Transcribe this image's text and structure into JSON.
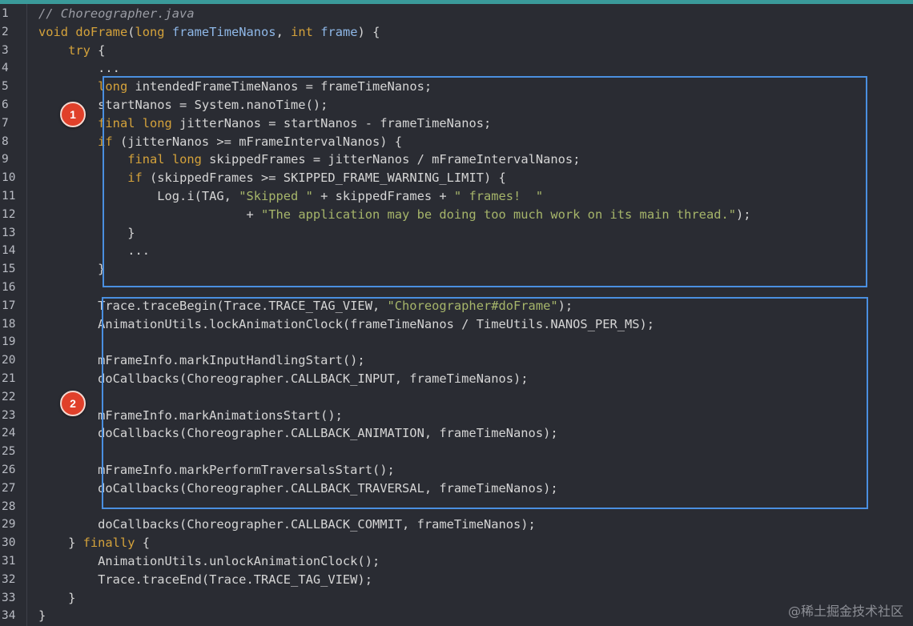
{
  "file_comment": "// Choreographer.java",
  "lines": [
    {
      "num": "1",
      "tokens": [
        {
          "t": "// Choreographer.java",
          "c": "cmt"
        }
      ]
    },
    {
      "num": "2",
      "tokens": [
        {
          "t": "void ",
          "c": "kw"
        },
        {
          "t": "doFrame",
          "c": "fn"
        },
        {
          "t": "(",
          "c": ""
        },
        {
          "t": "long ",
          "c": "kw"
        },
        {
          "t": "frameTimeNanos",
          "c": "prm"
        },
        {
          "t": ", ",
          "c": ""
        },
        {
          "t": "int ",
          "c": "kw"
        },
        {
          "t": "frame",
          "c": "prm"
        },
        {
          "t": ") {",
          "c": ""
        }
      ]
    },
    {
      "num": "3",
      "tokens": [
        {
          "t": "    ",
          "c": ""
        },
        {
          "t": "try",
          "c": "kw"
        },
        {
          "t": " {",
          "c": ""
        }
      ]
    },
    {
      "num": "4",
      "tokens": [
        {
          "t": "        ...",
          "c": ""
        }
      ]
    },
    {
      "num": "5",
      "tokens": [
        {
          "t": "        ",
          "c": ""
        },
        {
          "t": "long ",
          "c": "kw"
        },
        {
          "t": "intendedFrameTimeNanos = frameTimeNanos;",
          "c": ""
        }
      ]
    },
    {
      "num": "6",
      "tokens": [
        {
          "t": "        startNanos = System.nanoTime();",
          "c": ""
        }
      ]
    },
    {
      "num": "7",
      "tokens": [
        {
          "t": "        ",
          "c": ""
        },
        {
          "t": "final ",
          "c": "kw"
        },
        {
          "t": "long ",
          "c": "kw"
        },
        {
          "t": "jitterNanos = startNanos - frameTimeNanos;",
          "c": ""
        }
      ]
    },
    {
      "num": "8",
      "tokens": [
        {
          "t": "        ",
          "c": ""
        },
        {
          "t": "if",
          "c": "kw"
        },
        {
          "t": " (jitterNanos >= mFrameIntervalNanos) {",
          "c": ""
        }
      ]
    },
    {
      "num": "9",
      "tokens": [
        {
          "t": "            ",
          "c": ""
        },
        {
          "t": "final ",
          "c": "kw"
        },
        {
          "t": "long ",
          "c": "kw"
        },
        {
          "t": "skippedFrames = jitterNanos / mFrameIntervalNanos;",
          "c": ""
        }
      ]
    },
    {
      "num": "10",
      "tokens": [
        {
          "t": "            ",
          "c": ""
        },
        {
          "t": "if",
          "c": "kw"
        },
        {
          "t": " (skippedFrames >= SKIPPED_FRAME_WARNING_LIMIT) {",
          "c": ""
        }
      ]
    },
    {
      "num": "11",
      "tokens": [
        {
          "t": "                Log.i(TAG, ",
          "c": ""
        },
        {
          "t": "\"Skipped \"",
          "c": "str"
        },
        {
          "t": " + skippedFrames + ",
          "c": ""
        },
        {
          "t": "\" frames!  \"",
          "c": "str"
        }
      ]
    },
    {
      "num": "12",
      "tokens": [
        {
          "t": "                            + ",
          "c": ""
        },
        {
          "t": "\"The application may be doing too much work on its main thread.\"",
          "c": "str"
        },
        {
          "t": ");",
          "c": ""
        }
      ]
    },
    {
      "num": "13",
      "tokens": [
        {
          "t": "            }",
          "c": ""
        }
      ]
    },
    {
      "num": "14",
      "tokens": [
        {
          "t": "            ...",
          "c": ""
        }
      ]
    },
    {
      "num": "15",
      "tokens": [
        {
          "t": "        }",
          "c": ""
        }
      ]
    },
    {
      "num": "16",
      "tokens": []
    },
    {
      "num": "17",
      "tokens": [
        {
          "t": "        Trace.traceBegin(Trace.TRACE_TAG_VIEW, ",
          "c": ""
        },
        {
          "t": "\"Choreographer#doFrame\"",
          "c": "str"
        },
        {
          "t": ");",
          "c": ""
        }
      ]
    },
    {
      "num": "18",
      "tokens": [
        {
          "t": "        AnimationUtils.lockAnimationClock(frameTimeNanos / TimeUtils.NANOS_PER_MS);",
          "c": ""
        }
      ]
    },
    {
      "num": "19",
      "tokens": []
    },
    {
      "num": "20",
      "tokens": [
        {
          "t": "        mFrameInfo.markInputHandlingStart();",
          "c": ""
        }
      ]
    },
    {
      "num": "21",
      "tokens": [
        {
          "t": "        doCallbacks(Choreographer.CALLBACK_INPUT, frameTimeNanos);",
          "c": ""
        }
      ]
    },
    {
      "num": "22",
      "tokens": []
    },
    {
      "num": "23",
      "tokens": [
        {
          "t": "        mFrameInfo.markAnimationsStart();",
          "c": ""
        }
      ]
    },
    {
      "num": "24",
      "tokens": [
        {
          "t": "        doCallbacks(Choreographer.CALLBACK_ANIMATION, frameTimeNanos);",
          "c": ""
        }
      ]
    },
    {
      "num": "25",
      "tokens": []
    },
    {
      "num": "26",
      "tokens": [
        {
          "t": "        mFrameInfo.markPerformTraversalsStart();",
          "c": ""
        }
      ]
    },
    {
      "num": "27",
      "tokens": [
        {
          "t": "        doCallbacks(Choreographer.CALLBACK_TRAVERSAL, frameTimeNanos);",
          "c": ""
        }
      ]
    },
    {
      "num": "28",
      "tokens": []
    },
    {
      "num": "29",
      "tokens": [
        {
          "t": "        doCallbacks(Choreographer.CALLBACK_COMMIT, frameTimeNanos);",
          "c": ""
        }
      ]
    },
    {
      "num": "30",
      "tokens": [
        {
          "t": "    } ",
          "c": ""
        },
        {
          "t": "finally",
          "c": "kw"
        },
        {
          "t": " {",
          "c": ""
        }
      ]
    },
    {
      "num": "31",
      "tokens": [
        {
          "t": "        AnimationUtils.unlockAnimationClock();",
          "c": ""
        }
      ]
    },
    {
      "num": "32",
      "tokens": [
        {
          "t": "        Trace.traceEnd(Trace.TRACE_TAG_VIEW);",
          "c": ""
        }
      ]
    },
    {
      "num": "33",
      "tokens": [
        {
          "t": "    }",
          "c": ""
        }
      ]
    },
    {
      "num": "34",
      "tokens": [
        {
          "t": "}",
          "c": ""
        }
      ]
    }
  ],
  "badges": [
    {
      "label": "1",
      "color": "#e0402a"
    },
    {
      "label": "2",
      "color": "#e0402a"
    }
  ],
  "highlight_color": "#4a8fe0",
  "watermark": "@稀土掘金技术社区",
  "colors": {
    "background": "#2a2c33",
    "keyword": "#d4a23b",
    "parameter": "#8fb8e8",
    "string": "#a6b56a",
    "comment": "#9a9ca4",
    "text": "#d5d5d5",
    "top_border": "#3a9a9a"
  }
}
